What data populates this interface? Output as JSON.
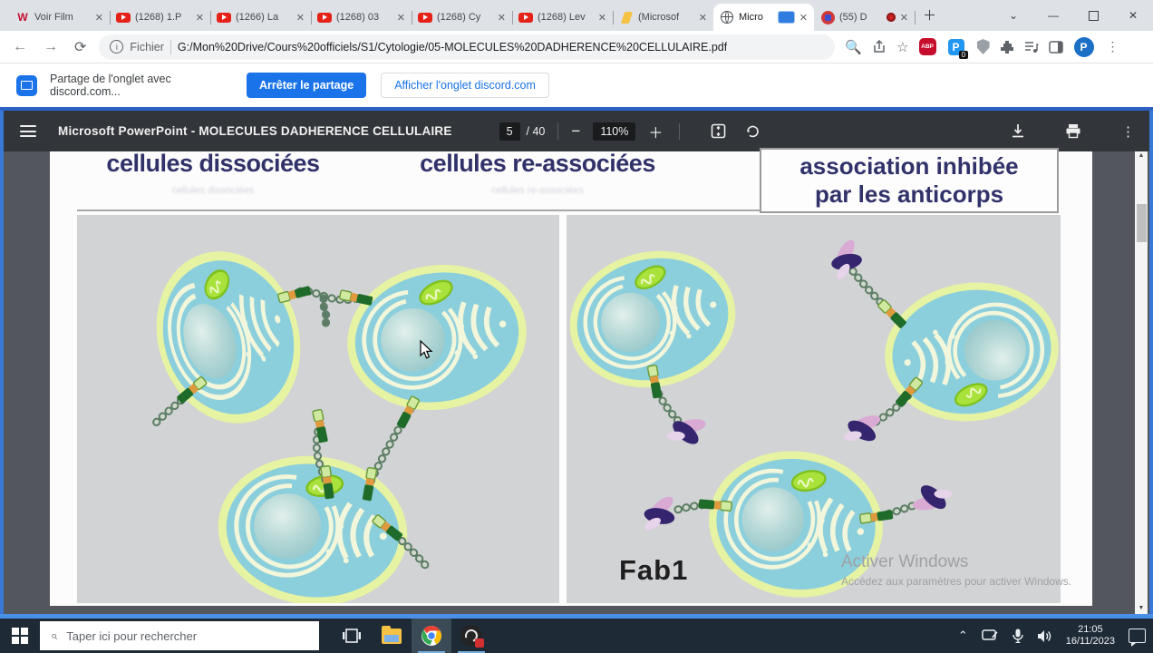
{
  "browser": {
    "tabs": [
      {
        "title": "Voir Film",
        "icon": "wiflix"
      },
      {
        "title": "(1268) 1.P",
        "icon": "youtube"
      },
      {
        "title": "(1266) La",
        "icon": "youtube"
      },
      {
        "title": "(1268) 03",
        "icon": "youtube"
      },
      {
        "title": "(1268) Cy",
        "icon": "youtube"
      },
      {
        "title": "(1268) Lev",
        "icon": "youtube"
      },
      {
        "title": "(Microsof",
        "icon": "yellow-doc"
      },
      {
        "title": "Micro",
        "icon": "globe",
        "state": "active, sharing this tab"
      },
      {
        "title": "(55) D",
        "icon": "discord",
        "state": "recording"
      }
    ],
    "url_scheme_label": "Fichier",
    "url": "G:/Mon%20Drive/Cours%20officiels/S1/Cytologie/05-MOLECULES%20DADHERENCE%20CELLULAIRE.pdf",
    "extension_badges": {
      "adblock": "ABP",
      "p_extension": "P",
      "p_badge": "0",
      "profile_initial": "P"
    }
  },
  "share_bar": {
    "message": "Partage de l'onglet avec discord.com...",
    "stop_button": "Arrêter le partage",
    "view_button": "Afficher l'onglet discord.com"
  },
  "pdf_toolbar": {
    "title": "Microsoft PowerPoint - MOLECULES DADHERENCE CELLULAIRE",
    "page_current": "5",
    "page_total": "/ 40",
    "zoom_level": "110%"
  },
  "slide": {
    "heading_left": "cellules dissociées",
    "heading_center": "cellules re-associées",
    "heading_right_line1": "association inhibée",
    "heading_right_line2": "par les anticorps",
    "fab_label": "Fab1"
  },
  "watermark": {
    "line1": "Activer Windows",
    "line2": "Accédez aux paramètres pour activer Windows."
  },
  "taskbar": {
    "search_placeholder": "Taper ici pour rechercher",
    "time": "21:05",
    "date": "16/11/2023"
  },
  "colors": {
    "accent_blue": "#1a73e8",
    "share_frame_blue": "#3a78d6",
    "pdf_toolbar_bg": "#32363a",
    "pdf_area_bg": "#53565c",
    "taskbar_bg": "#1e2a36",
    "heading_text": "#32326b",
    "cell_fill": "#8ccfdc",
    "cell_membrane": "#e6f3a2",
    "mitochondria_green": "#a8e23a",
    "antibody_purple": "#35246e",
    "antibody_pink": "#d9abd4"
  }
}
